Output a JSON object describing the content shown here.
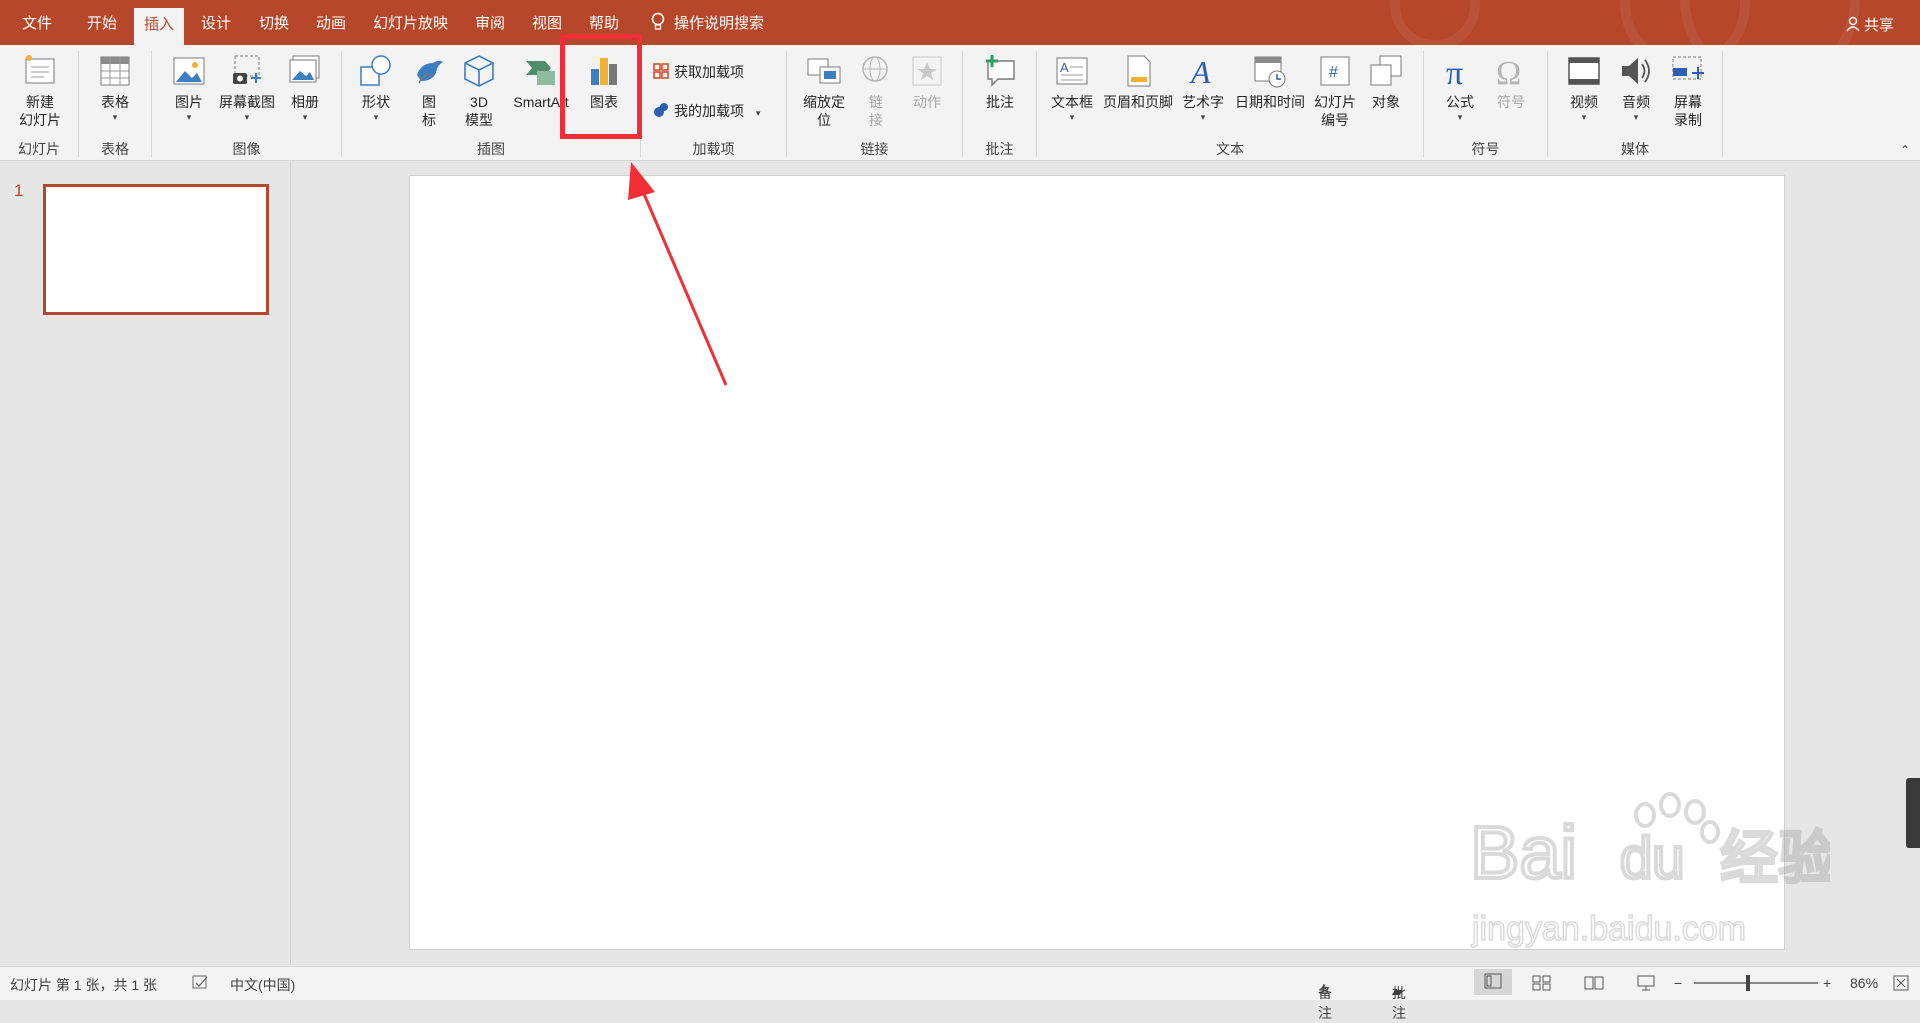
{
  "tabs": [
    "文件",
    "开始",
    "插入",
    "设计",
    "切换",
    "动画",
    "幻灯片放映",
    "审阅",
    "视图",
    "帮助"
  ],
  "tell_me": "操作说明搜索",
  "share": "共享",
  "ribbon": {
    "new_slide": "新建\n幻灯片",
    "table": "表格",
    "pictures": "图片",
    "screenshot": "屏幕截图",
    "album": "相册",
    "shapes": "形状",
    "icons": "图\n标",
    "models3d": "3D\n模型",
    "smartart": "SmartArt",
    "chart": "图表",
    "get_addins": "获取加载项",
    "my_addins": "我的加载项",
    "zoom": "缩放定\n位",
    "link": "链\n接",
    "action": "动作",
    "comment": "批注",
    "textbox": "文本框",
    "header_footer": "页眉和页脚",
    "wordart": "艺术字",
    "datetime": "日期和时间",
    "slide_number": "幻灯片\n编号",
    "object": "对象",
    "equation": "公式",
    "symbol": "符号",
    "video": "视频",
    "audio": "音频",
    "screen_recording": "屏幕\n录制"
  },
  "groups": [
    "幻灯片",
    "表格",
    "图像",
    "插图",
    "加载项",
    "链接",
    "批注",
    "文本",
    "符号",
    "媒体"
  ],
  "thumbnail": {
    "number": "1"
  },
  "status": {
    "slide_info": "幻灯片 第 1 张，共 1 张",
    "language": "中文(中国)",
    "notes": "备注",
    "comments": "批注",
    "zoom": "86%",
    "zoom_fraction": 0.43
  },
  "watermark": {
    "logo": "Bai du 经验",
    "url": "jingyan.baidu.com"
  },
  "colors": {
    "accent": "#b7472a",
    "highlight": "#f12f35"
  }
}
